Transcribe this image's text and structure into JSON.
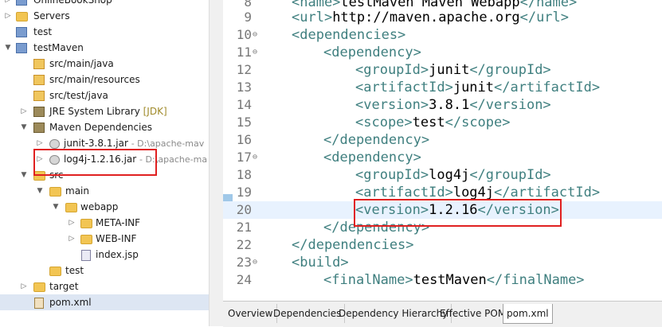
{
  "explorer": {
    "items": [
      {
        "label": "OnlineBookShop",
        "decoration": ""
      },
      {
        "label": "Servers",
        "decoration": ""
      },
      {
        "label": "test",
        "decoration": ""
      },
      {
        "label": "testMaven",
        "decoration": ""
      },
      {
        "label": "src/main/java",
        "decoration": ""
      },
      {
        "label": "src/main/resources",
        "decoration": ""
      },
      {
        "label": "src/test/java",
        "decoration": ""
      },
      {
        "label": "JRE System Library",
        "decoration": "[JDK]"
      },
      {
        "label": "Maven Dependencies",
        "decoration": ""
      },
      {
        "label": "junit-3.8.1.jar",
        "decoration": "- D:\\apache-mav"
      },
      {
        "label": "log4j-1.2.16.jar",
        "decoration": "- D:\\apache-ma"
      },
      {
        "label": "src",
        "decoration": ""
      },
      {
        "label": "main",
        "decoration": ""
      },
      {
        "label": "webapp",
        "decoration": ""
      },
      {
        "label": "META-INF",
        "decoration": ""
      },
      {
        "label": "WEB-INF",
        "decoration": ""
      },
      {
        "label": "index.jsp",
        "decoration": ""
      },
      {
        "label": "test",
        "decoration": ""
      },
      {
        "label": "target",
        "decoration": ""
      },
      {
        "label": "pom.xml",
        "decoration": ""
      }
    ]
  },
  "editor": {
    "lines": [
      {
        "num": "8",
        "fold": "",
        "open": "<name>",
        "text": "testMaven Maven Webapp",
        "close": "</name>"
      },
      {
        "num": "9",
        "fold": "",
        "open": "<url>",
        "text": "http://maven.apache.org",
        "close": "</url>"
      },
      {
        "num": "10",
        "fold": "⊖",
        "open": "<dependencies>",
        "text": "",
        "close": ""
      },
      {
        "num": "11",
        "fold": "⊖",
        "open": "<dependency>",
        "text": "",
        "close": ""
      },
      {
        "num": "12",
        "fold": "",
        "open": "<groupId>",
        "text": "junit",
        "close": "</groupId>"
      },
      {
        "num": "13",
        "fold": "",
        "open": "<artifactId>",
        "text": "junit",
        "close": "</artifactId>"
      },
      {
        "num": "14",
        "fold": "",
        "open": "<version>",
        "text": "3.8.1",
        "close": "</version>"
      },
      {
        "num": "15",
        "fold": "",
        "open": "<scope>",
        "text": "test",
        "close": "</scope>"
      },
      {
        "num": "16",
        "fold": "",
        "open": "</dependency>",
        "text": "",
        "close": ""
      },
      {
        "num": "17",
        "fold": "⊖",
        "open": "<dependency>",
        "text": "",
        "close": ""
      },
      {
        "num": "18",
        "fold": "",
        "open": "<groupId>",
        "text": "log4j",
        "close": "</groupId>"
      },
      {
        "num": "19",
        "fold": "",
        "open": "<artifactId>",
        "text": "log4j",
        "close": "</artifactId>"
      },
      {
        "num": "20",
        "fold": "",
        "open": "<version>",
        "text": "1.2.16",
        "close": "</version>"
      },
      {
        "num": "21",
        "fold": "",
        "open": "</dependency>",
        "text": "",
        "close": ""
      },
      {
        "num": "22",
        "fold": "",
        "open": "</dependencies>",
        "text": "",
        "close": ""
      },
      {
        "num": "23",
        "fold": "⊖",
        "open": "<build>",
        "text": "",
        "close": ""
      },
      {
        "num": "24",
        "fold": "",
        "open": "<finalName>",
        "text": "testMaven",
        "close": "</finalName>"
      }
    ]
  },
  "tabs": [
    "Overview",
    "Dependencies",
    "Dependency Hierarchy",
    "Effective POM",
    "pom.xml"
  ],
  "active_tab": "pom.xml",
  "colors": {
    "tag": "#3f7f7f",
    "highlight": "#e8f2fe",
    "annotation": "#e02020"
  }
}
